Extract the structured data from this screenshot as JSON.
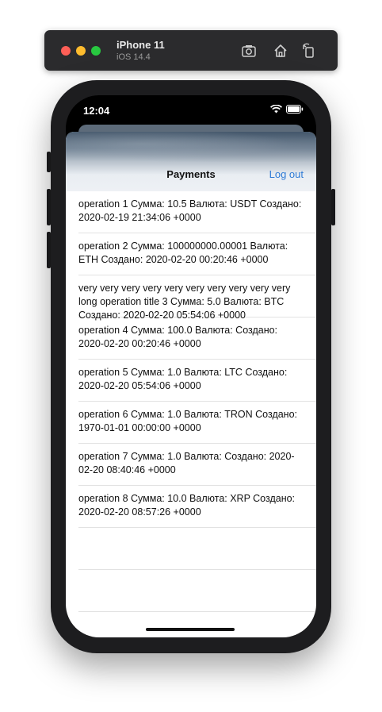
{
  "simulator": {
    "device_name": "iPhone 11",
    "os_version": "iOS 14.4",
    "icons": [
      "screenshot-icon",
      "home-icon",
      "rotate-icon"
    ]
  },
  "status_bar": {
    "time": "12:04",
    "icons": [
      "wifi-icon",
      "battery-icon"
    ]
  },
  "nav": {
    "title": "Payments",
    "logout_label": "Log out"
  },
  "payments": [
    {
      "text": " operation 1  Сумма: 10.5 Валюта: USDT Создано: 2020-02-19 21:34:06 +0000"
    },
    {
      "text": " operation 2  Сумма: 100000000.00001 Валюта: ETH Создано: 2020-02-20 00:20:46 +0000"
    },
    {
      "text": " very very very very very very very very very very long operation title 3  Сумма: 5.0 Валюта: BTC Создано: 2020-02-20 05:54:06 +0000"
    },
    {
      "text": " operation 4  Сумма: 100.0 Валюта:  Создано: 2020-02-20 00:20:46 +0000"
    },
    {
      "text": " operation 5  Сумма: 1.0 Валюта: LTC Создано: 2020-02-20 05:54:06 +0000"
    },
    {
      "text": " operation 6  Сумма: 1.0 Валюта: TRON Создано: 1970-01-01 00:00:00 +0000"
    },
    {
      "text": " operation 7  Сумма: 1.0 Валюта:  Создано: 2020-02-20 08:40:46 +0000"
    },
    {
      "text": " operation 8  Сумма: 10.0 Валюта: XRP Создано: 2020-02-20 08:57:26 +0000"
    },
    {
      "text": ""
    },
    {
      "text": ""
    }
  ]
}
